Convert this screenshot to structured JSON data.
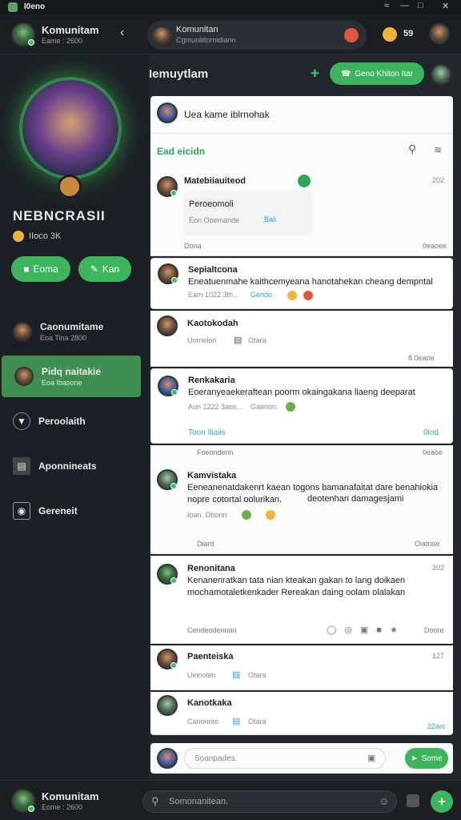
{
  "window": {
    "title": "I0eno",
    "controls": [
      "wifi-icon",
      "minimize-icon",
      "maximize-icon",
      "close-icon"
    ]
  },
  "topbar": {
    "user_name": "Komunitam",
    "user_sub": "Eame : 2600",
    "search_title": "Komunitan",
    "search_sub": "Cgmunliitornidiann",
    "count": "59"
  },
  "profile": {
    "name": "NEBNCRASII",
    "score": "IIoco 3K",
    "btn1": "Eoma",
    "btn2": "Kan"
  },
  "nav": [
    {
      "label": "Caonumitame",
      "sub": "Eoa Tina 2800"
    },
    {
      "label": "Pidq naitakie",
      "sub": "Eoa Ibasone"
    },
    {
      "label": "Peroolaith",
      "sub": ""
    },
    {
      "label": "Aponnineats",
      "sub": ""
    },
    {
      "label": "Gereneit",
      "sub": ""
    }
  ],
  "main": {
    "title": "Iemuytlam",
    "action_btn": "Geno Khiton Itar"
  },
  "composer": {
    "placeholder": "Uea kame iblrnohak",
    "tab": "Ead eicidn"
  },
  "posts": [
    {
      "name": "Matebiiauiteod",
      "time": "202",
      "line1": "Peroeomoli",
      "line2a": "Eon Ooemande",
      "line2b": "Bali",
      "foot": "Dona",
      "foot_r": "0eaoee"
    },
    {
      "name": "Sepialtcona",
      "text": "Eneatuenmahe kaithcemyeana hanotahekan cheang dempntal",
      "meta_a": "Eam 1022 3th...",
      "meta_b": "Gendo"
    },
    {
      "name": "Kaotokodah",
      "sub": "Uornelon",
      "sub2": "Otara",
      "foot_r": "8 0eaoe"
    },
    {
      "name": "Renkakaria",
      "text": "Eoeranyeaekeraftean poorm okaingakana liaeng deeparat",
      "meta_a": "Aun 1222 3ans...",
      "meta_b": "Gaenon.",
      "link": "Toon Iliaiis",
      "link_r": "0iod"
    },
    {
      "name": "Kamvistaka",
      "pre": "Foeondenn",
      "pre_r": "0eaoe",
      "text": "Eeneanenatdakenrt kaean togons bamanafaitat dare benahiokia nopre cotortal oolurikan.",
      "text2": "deotenhan damagesjami",
      "meta": "Ioan. Obonn",
      "foot": "Diard",
      "foot_r": "Oiatnoe"
    },
    {
      "name": "Renonitana",
      "time": "202",
      "text": "Kenanenratkan tata nian kteakan gakan to lang doikaen mochamotaletkenkader Rereakan daing oolam olalakan",
      "foot": "Cendeodennan",
      "foot_r": "Doore"
    },
    {
      "name": "Paenteiska",
      "time": "127",
      "sub": "Uinnolen",
      "sub2": "Otara"
    },
    {
      "name": "Kanotkaka",
      "sub": "Canonnte",
      "sub2": "Otara",
      "foot_r": "22arc"
    }
  ],
  "reply": {
    "placeholder": "Soanpades.",
    "btn": "Some"
  },
  "bottombar": {
    "user_name": "Komunitam",
    "user_sub": "Eome : 2600",
    "search": "Somonanitean."
  }
}
